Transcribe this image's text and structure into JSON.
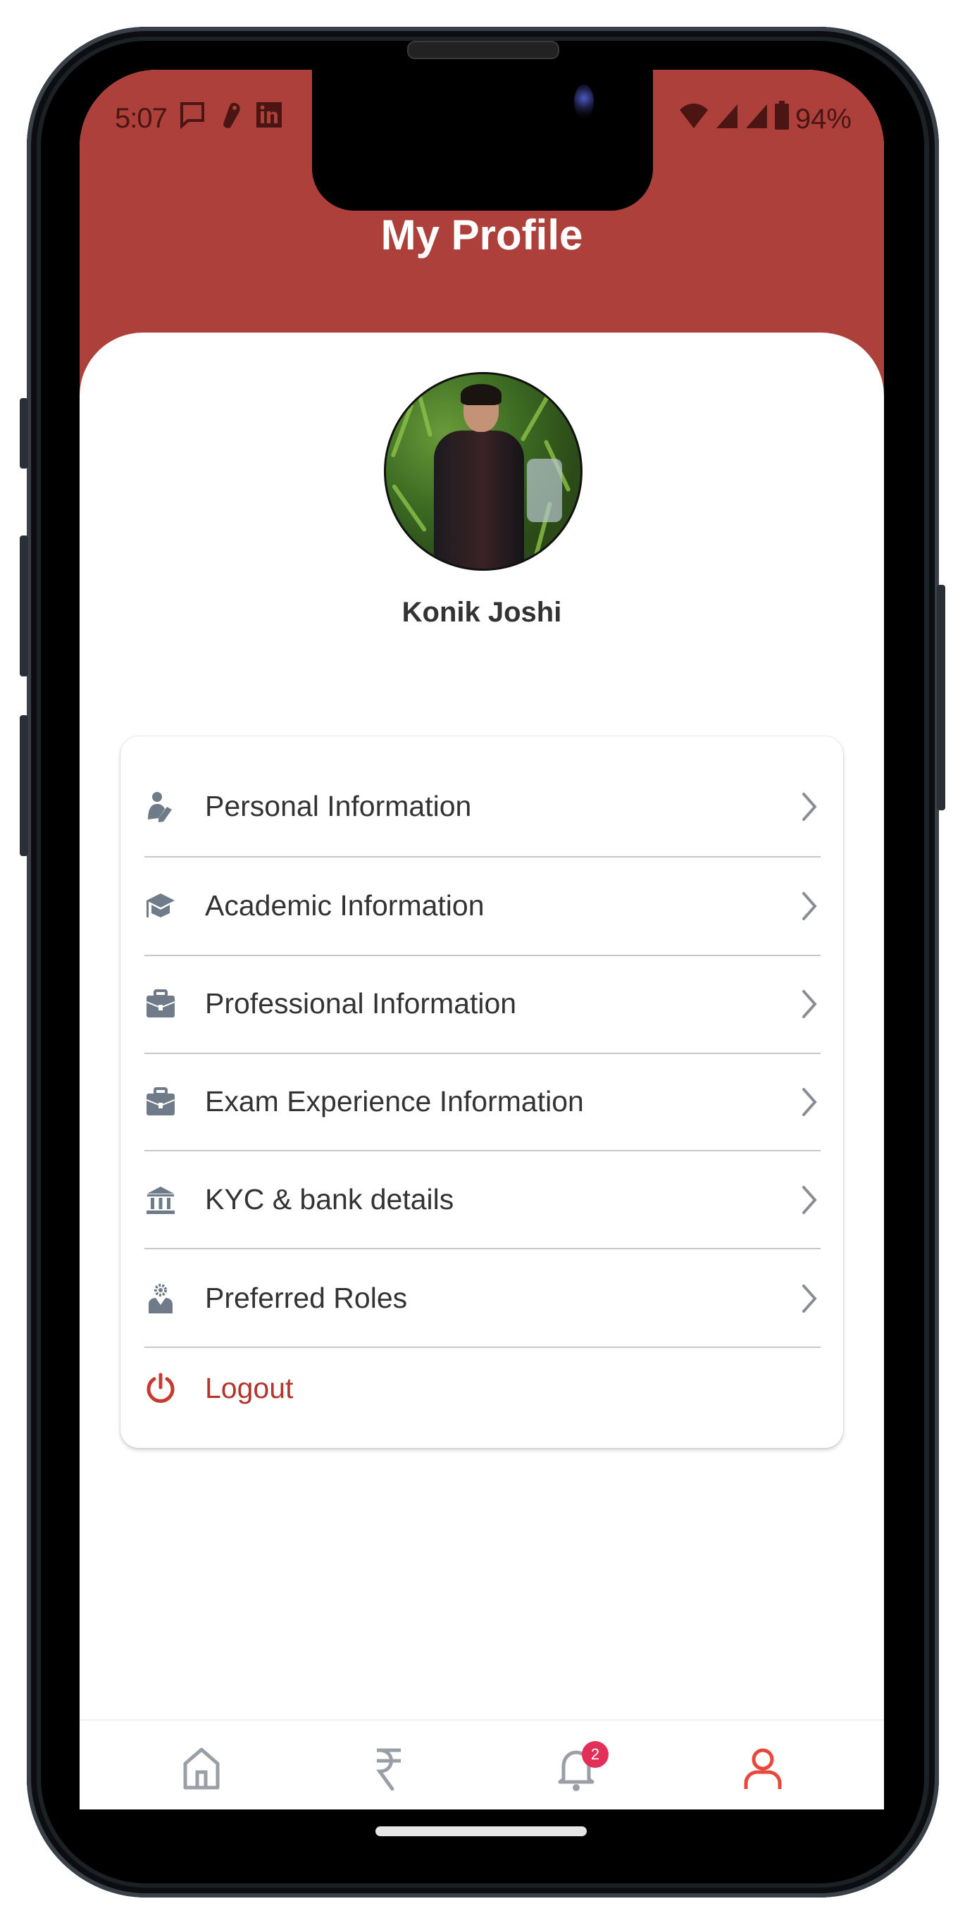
{
  "status_bar": {
    "time": "5:07",
    "left_icons": [
      "message-icon",
      "app-icon",
      "linkedin-icon"
    ],
    "right_icons": [
      "wifi-icon",
      "signal-icon",
      "signal-icon",
      "battery-icon"
    ],
    "battery": "94%"
  },
  "header": {
    "title": "My Profile",
    "color": "#ad403a"
  },
  "profile": {
    "name": "Konik Joshi",
    "avatar": "profile-photo"
  },
  "menu": {
    "items": [
      {
        "label": "Personal Information",
        "icon": "person-edit-icon"
      },
      {
        "label": "Academic Information",
        "icon": "graduation-cap-icon"
      },
      {
        "label": "Professional Information",
        "icon": "briefcase-icon"
      },
      {
        "label": "Exam Experience Information",
        "icon": "briefcase-icon"
      },
      {
        "label": "KYC & bank details",
        "icon": "bank-icon"
      },
      {
        "label": "Preferred Roles",
        "icon": "user-gear-icon"
      }
    ],
    "logout": {
      "label": "Logout",
      "icon": "power-icon",
      "color": "#b3352c"
    }
  },
  "bottom_nav": {
    "items": [
      {
        "name": "home",
        "icon": "home-icon",
        "active": false
      },
      {
        "name": "payments",
        "icon": "rupee-icon",
        "active": false
      },
      {
        "name": "notifications",
        "icon": "bell-icon",
        "active": false,
        "badge": "2"
      },
      {
        "name": "profile",
        "icon": "user-icon",
        "active": true
      }
    ],
    "active_color": "#e8473b",
    "inactive_color": "#9a9ea6",
    "badge_color": "#e0305a"
  }
}
